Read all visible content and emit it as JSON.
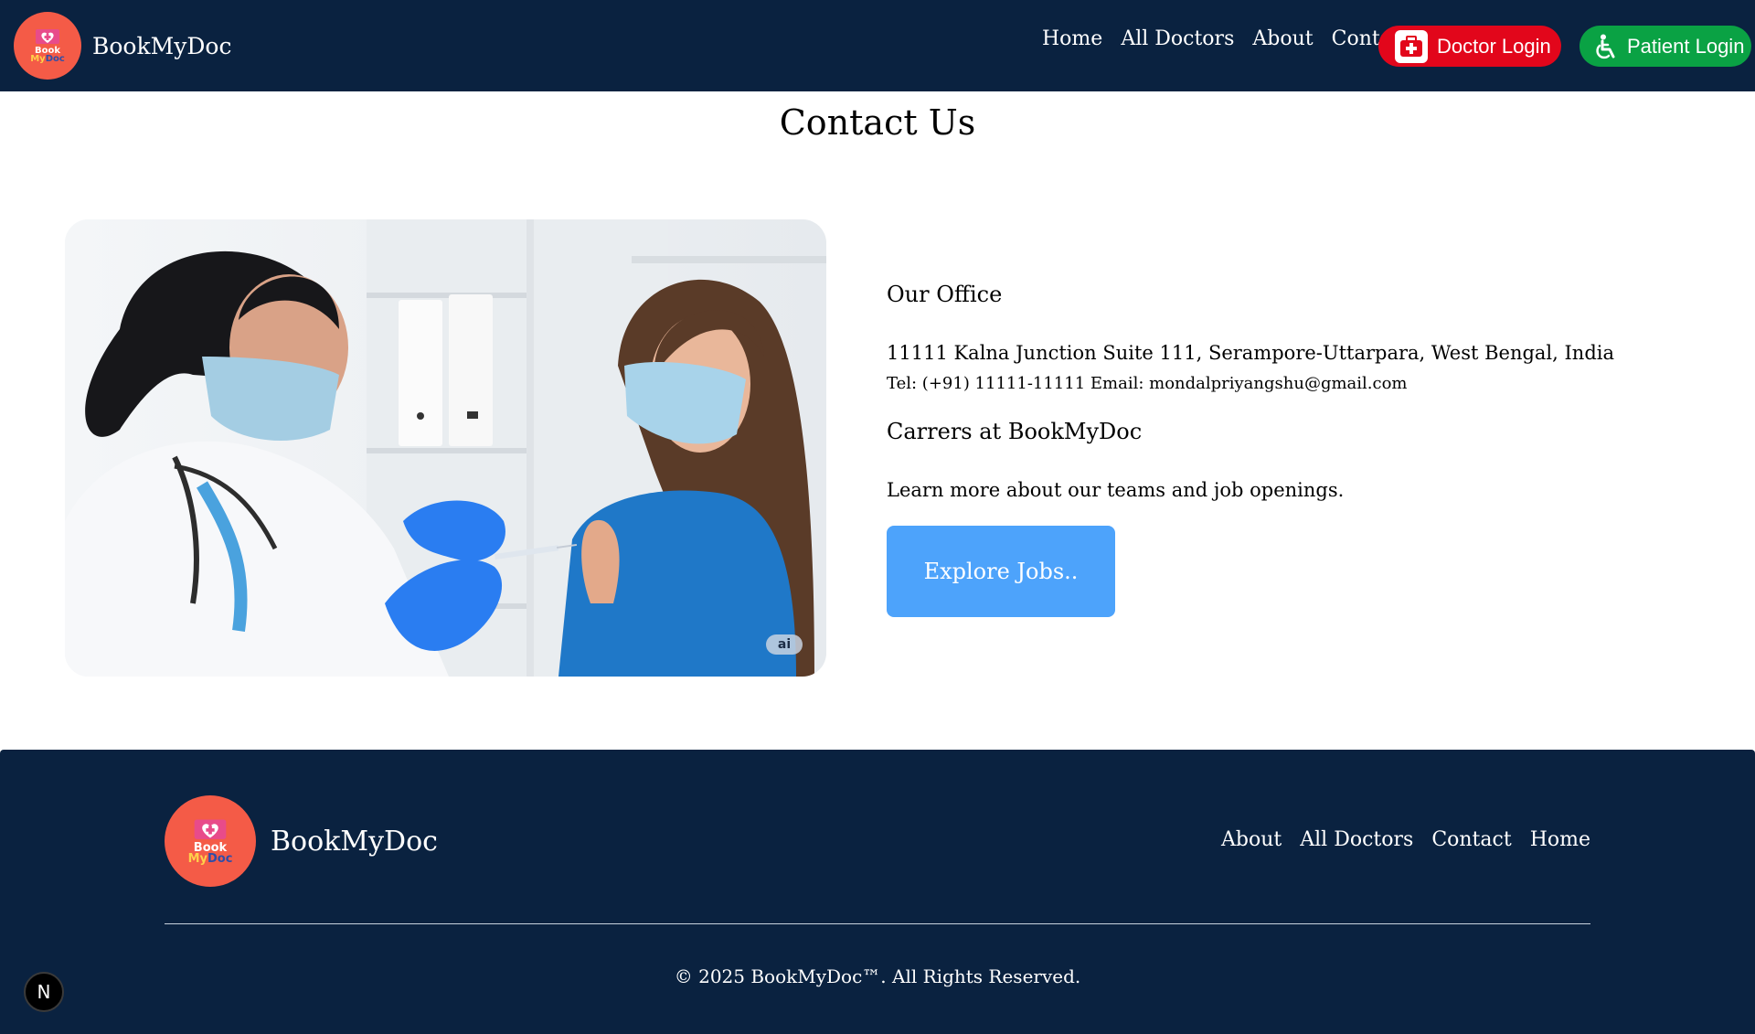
{
  "colors": {
    "nav_bg": "#0a2240",
    "doctor_btn": "#e2061b",
    "patient_btn": "#0aa244",
    "jobs_btn": "#4da3fb",
    "logo_bg": "#f45b47"
  },
  "header": {
    "logo_word_1": "Book",
    "logo_word_2": "My",
    "logo_word_3": "Doc",
    "brand": "BookMyDoc",
    "nav": [
      "Home",
      "All Doctors",
      "About",
      "Contact"
    ],
    "doctor_login": "Doctor Login",
    "patient_login": "Patient Login",
    "doctor_icon": "first-aid-kit-icon",
    "patient_icon": "wheelchair-icon"
  },
  "main": {
    "title": "Contact Us",
    "image_badge": "ai",
    "office_title": "Our Office",
    "address": "11111 Kalna Junction Suite 111, Serampore-Uttarpara, West Bengal, India",
    "contact_line": "Tel: (+91) 11111-11111 Email: mondalpriyangshu@gmail.com",
    "careers_title": "Carrers at BookMyDoc",
    "careers_text": "Learn more about our teams and job openings.",
    "jobs_button": "Explore Jobs.."
  },
  "footer": {
    "brand": "BookMyDoc",
    "links": [
      "About",
      "All Doctors",
      "Contact",
      "Home"
    ],
    "copyright": "© 2025 BookMyDoc™. All Rights Reserved."
  },
  "dev_badge": "N"
}
